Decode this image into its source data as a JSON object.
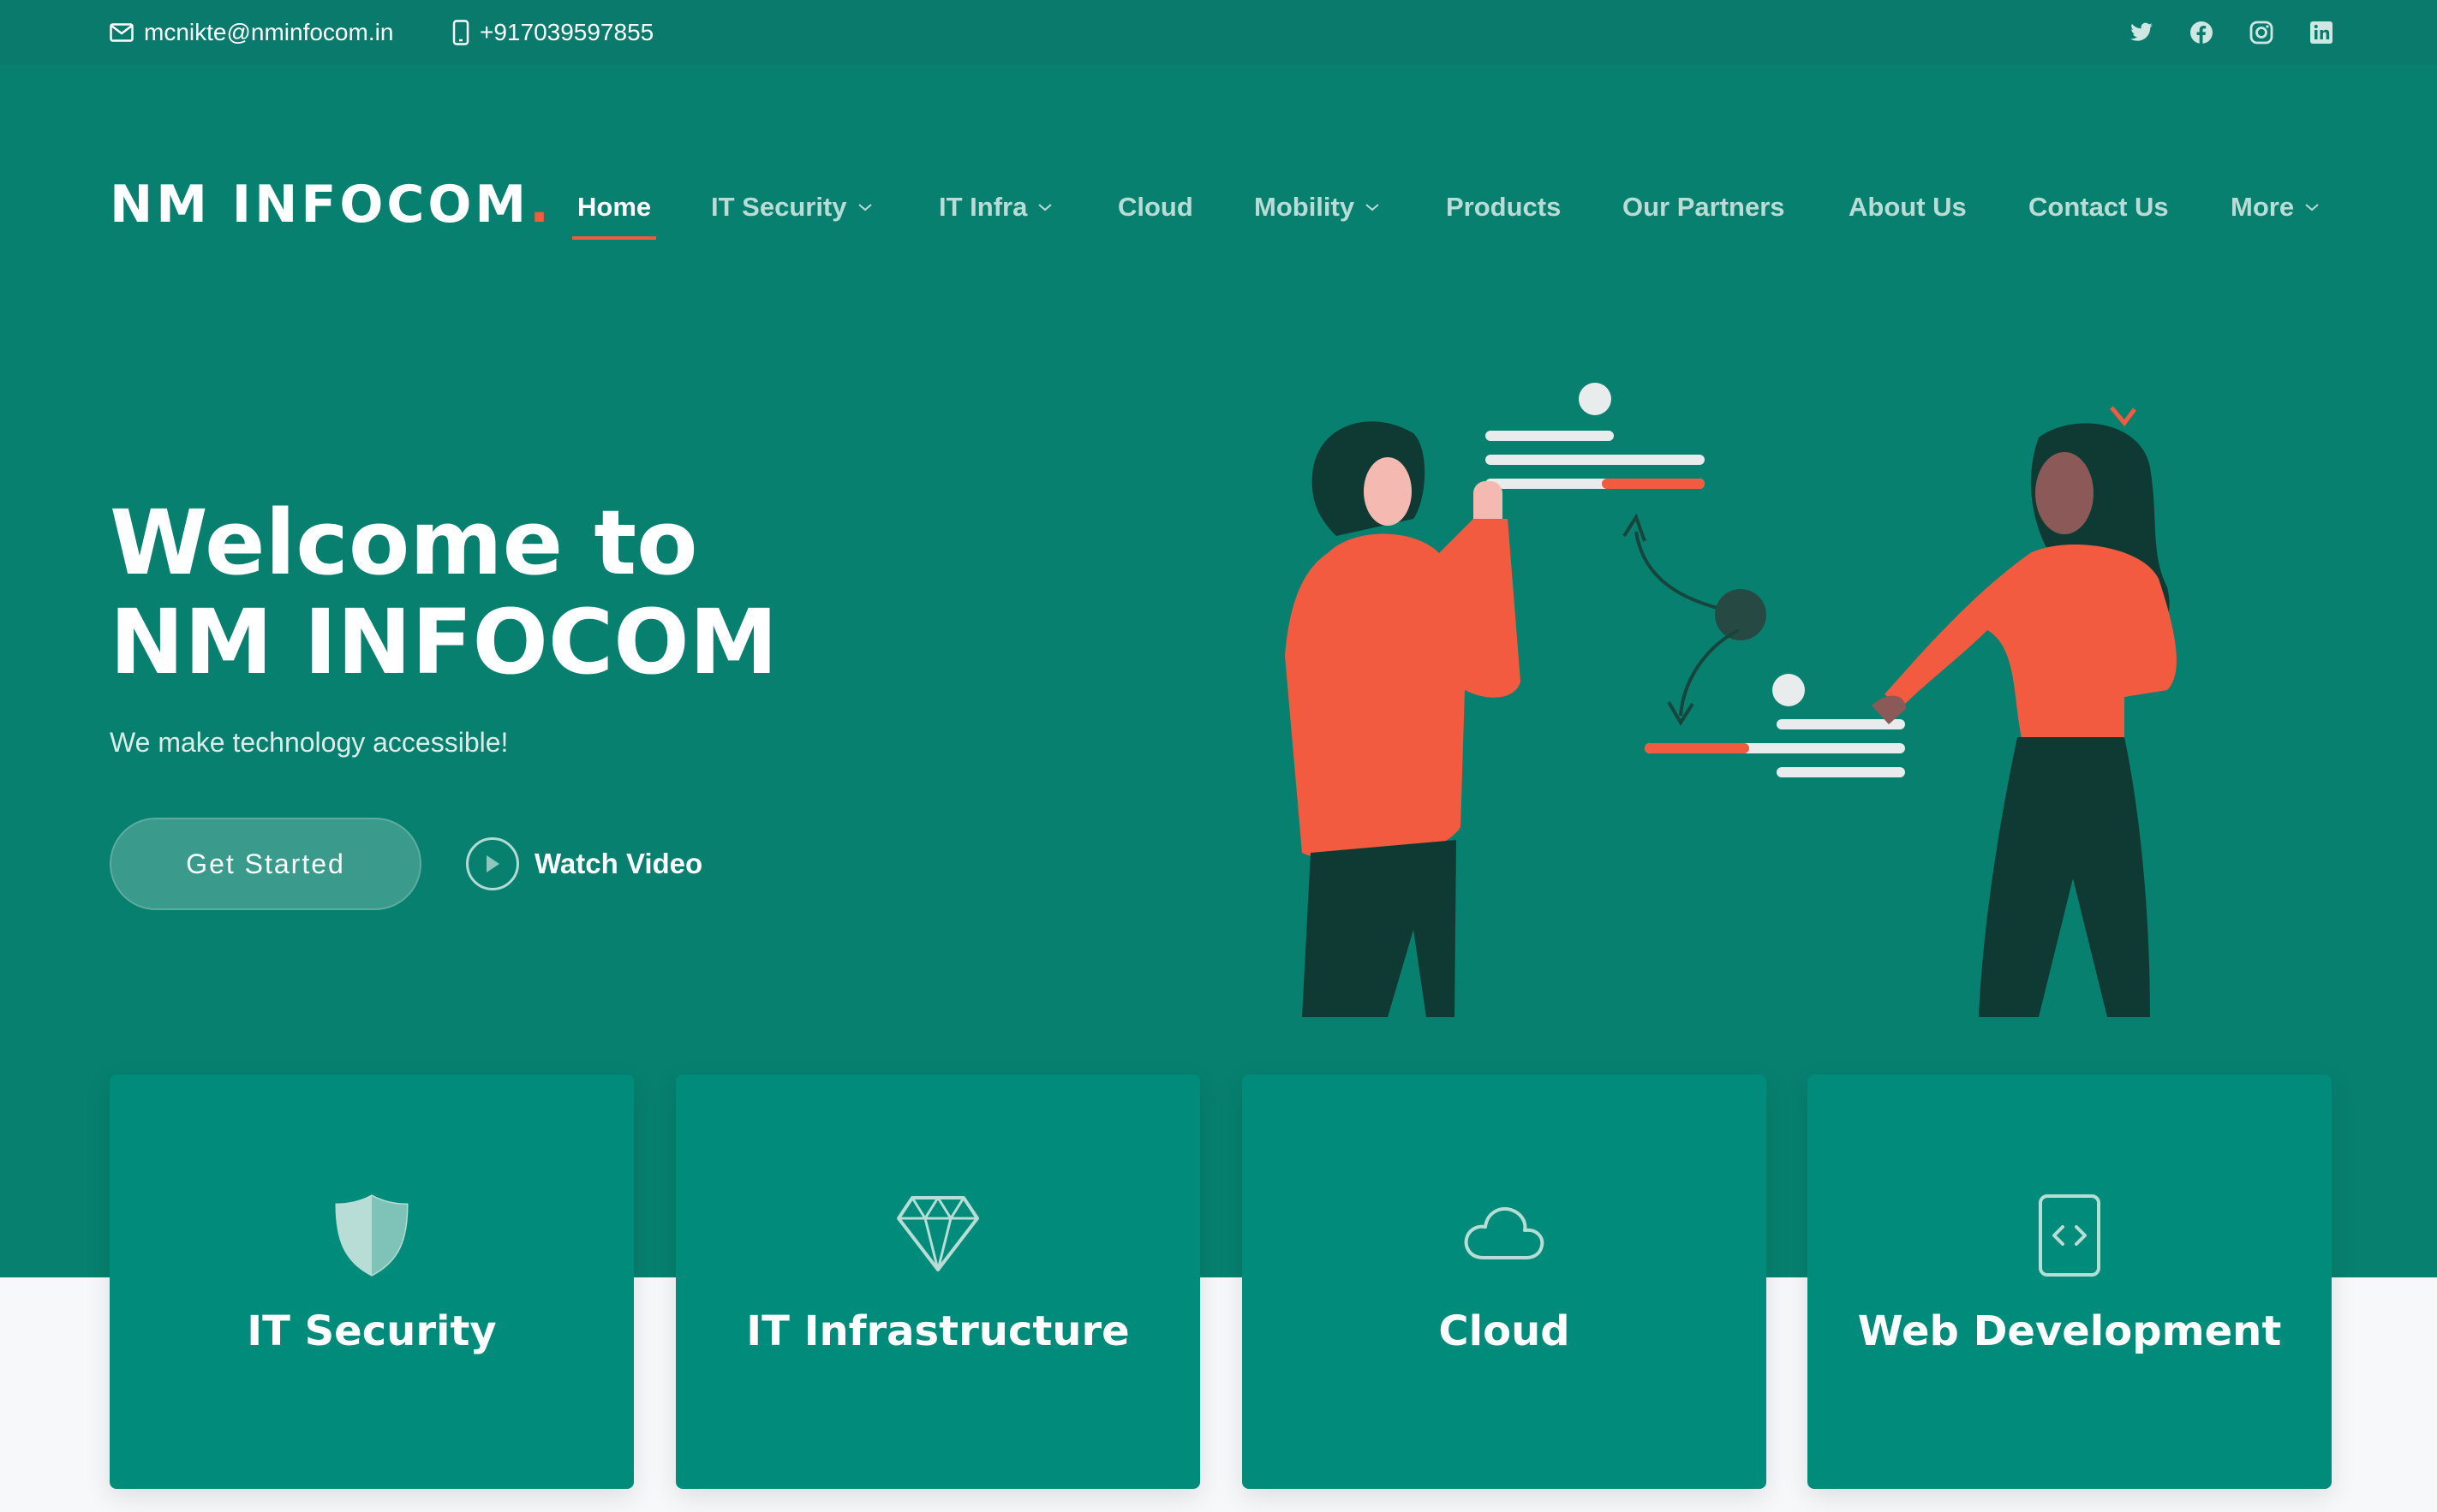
{
  "topbar": {
    "email": "mcnikte@nminfocom.in",
    "phone": "+917039597855",
    "social": [
      "twitter-icon",
      "facebook-icon",
      "instagram-icon",
      "linkedin-icon"
    ]
  },
  "brand": {
    "name": "NM INFOCOM",
    "dot": ".",
    "accent_color": "#f25b40",
    "primary_color": "#07806f"
  },
  "nav": {
    "items": [
      {
        "label": "Home",
        "active": true
      },
      {
        "label": "IT Security",
        "dropdown": true
      },
      {
        "label": "IT Infra",
        "dropdown": true
      },
      {
        "label": "Cloud"
      },
      {
        "label": "Mobility",
        "dropdown": true
      },
      {
        "label": "Products"
      },
      {
        "label": "Our Partners"
      },
      {
        "label": "About Us"
      },
      {
        "label": "Contact Us"
      },
      {
        "label": "More",
        "dropdown": true
      }
    ]
  },
  "hero": {
    "title": "Welcome to NM INFOCOM",
    "subtitle": "We make technology accessible!",
    "cta_primary": "Get Started",
    "cta_secondary": "Watch Video"
  },
  "cards": [
    {
      "title": "IT Security",
      "icon": "shield-icon"
    },
    {
      "title": "IT Infrastructure",
      "icon": "diamond-icon"
    },
    {
      "title": "Cloud",
      "icon": "cloud-icon"
    },
    {
      "title": "Web Development",
      "icon": "code-file-icon"
    }
  ]
}
